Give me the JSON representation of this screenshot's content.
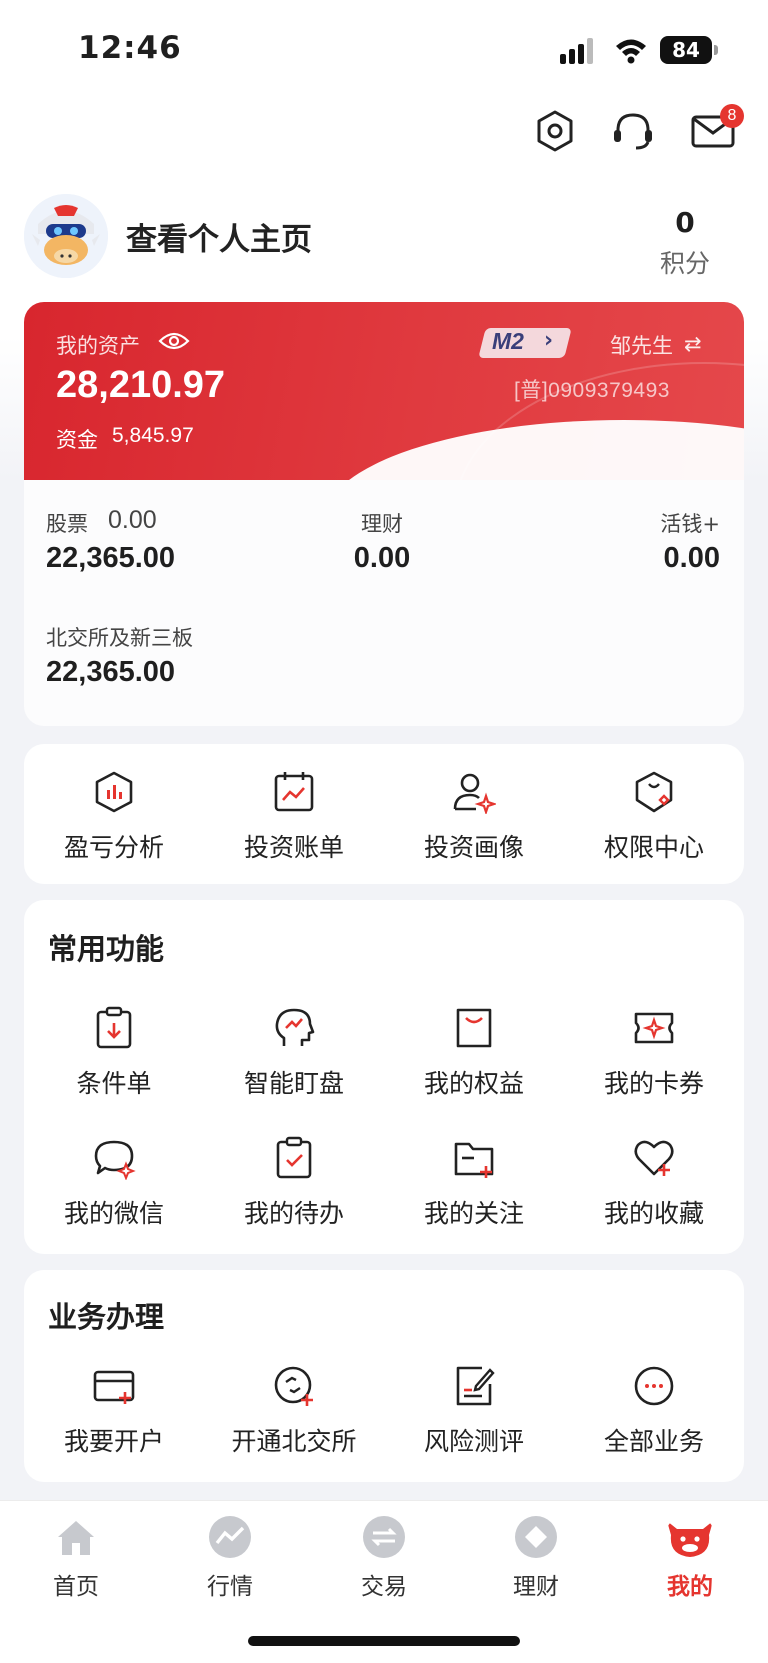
{
  "status_bar": {
    "time": "12:46",
    "battery": "84"
  },
  "header": {
    "message_badge": "8"
  },
  "profile": {
    "name": "查看个人主页",
    "points_value": "0",
    "points_label": "积分"
  },
  "asset_card": {
    "label": "我的资产",
    "total": "28,210.97",
    "cash_label": "资金",
    "cash_value": "5,845.97",
    "level_badge": "M2",
    "account_name": "邹先生",
    "account_no": "[普]0909379493"
  },
  "holdings": {
    "stocks": {
      "label": "股票",
      "change": "0.00",
      "value": "22,365.00"
    },
    "wealth": {
      "label": "理财",
      "value": "0.00"
    },
    "cash_plus": {
      "label": "活钱+",
      "value": "0.00"
    },
    "bse": {
      "label": "北交所及新三板",
      "value": "22,365.00"
    }
  },
  "quick_tools": [
    {
      "label": "盈亏分析",
      "icon": "pnl-analysis-icon"
    },
    {
      "label": "投资账单",
      "icon": "investment-bill-icon"
    },
    {
      "label": "投资画像",
      "icon": "investor-profile-icon"
    },
    {
      "label": "权限中心",
      "icon": "permission-center-icon"
    }
  ],
  "common_functions": {
    "title": "常用功能",
    "items": [
      {
        "label": "条件单",
        "icon": "conditional-order-icon"
      },
      {
        "label": "智能盯盘",
        "icon": "smart-monitor-icon"
      },
      {
        "label": "我的权益",
        "icon": "my-benefits-icon"
      },
      {
        "label": "我的卡券",
        "icon": "my-coupons-icon"
      },
      {
        "label": "我的微信",
        "icon": "my-wechat-icon"
      },
      {
        "label": "我的待办",
        "icon": "my-todo-icon"
      },
      {
        "label": "我的关注",
        "icon": "my-follow-icon"
      },
      {
        "label": "我的收藏",
        "icon": "my-favorites-icon"
      }
    ]
  },
  "business": {
    "title": "业务办理",
    "items": [
      {
        "label": "我要开户",
        "icon": "open-account-icon"
      },
      {
        "label": "开通北交所",
        "icon": "open-bse-icon"
      },
      {
        "label": "风险测评",
        "icon": "risk-assessment-icon"
      },
      {
        "label": "全部业务",
        "icon": "all-business-icon"
      }
    ]
  },
  "tabbar": [
    {
      "label": "首页",
      "icon": "home-icon"
    },
    {
      "label": "行情",
      "icon": "market-icon"
    },
    {
      "label": "交易",
      "icon": "trade-icon"
    },
    {
      "label": "理财",
      "icon": "wealth-icon"
    },
    {
      "label": "我的",
      "icon": "mine-icon",
      "active": true
    }
  ],
  "colors": {
    "accent": "#e5352f",
    "text": "#1f1f1f",
    "muted": "#c7c9ce"
  }
}
